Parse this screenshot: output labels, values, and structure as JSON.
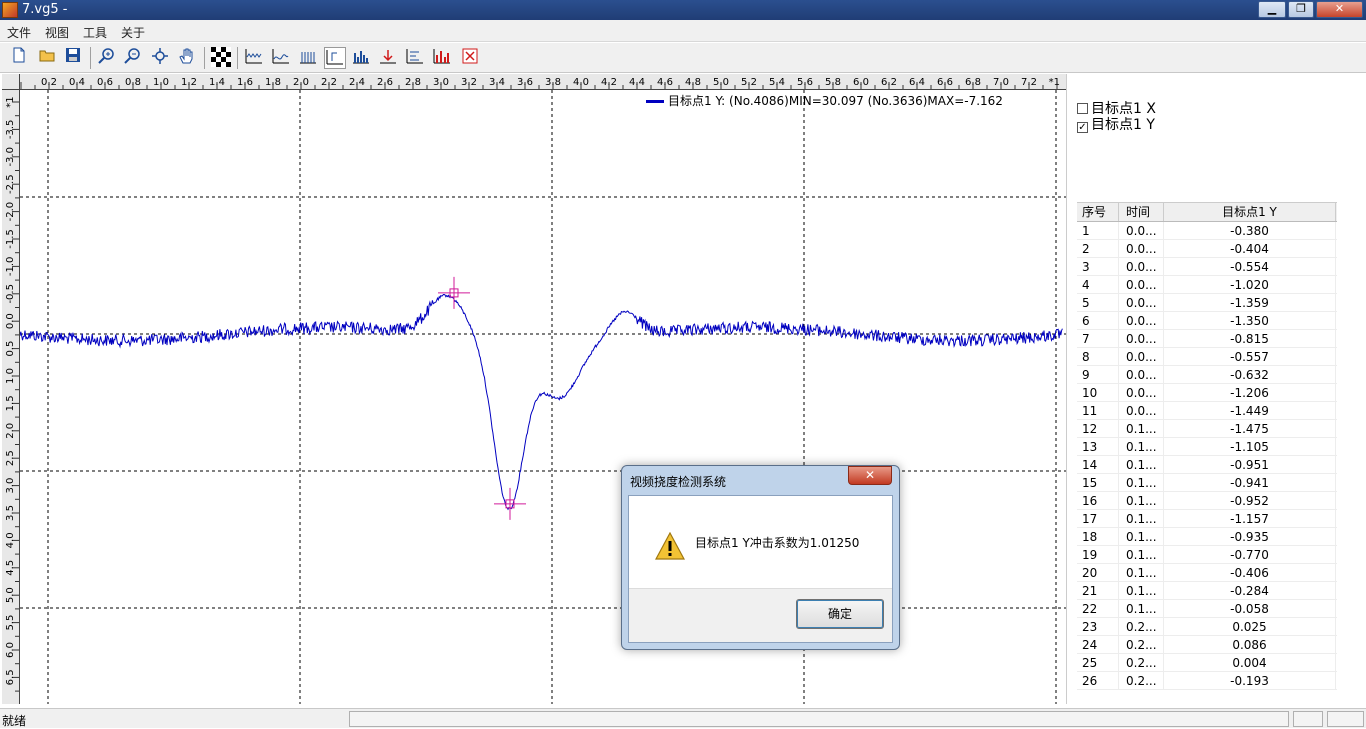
{
  "window": {
    "title": "7.vg5 -",
    "min": "▁",
    "max": "❐",
    "close": "✕"
  },
  "menu": [
    "文件",
    "视图",
    "工具",
    "关于"
  ],
  "toolbar_icons": [
    "new-file-icon",
    "open-folder-icon",
    "save-icon",
    "zoom-in-icon",
    "zoom-out-icon",
    "fit-view-icon",
    "pan-hand-icon",
    "checkerboard-icon",
    "wave-icon-1",
    "wave-icon-2",
    "bars-icon-1",
    "cursor-icon",
    "bars-icon-2",
    "marker-icon",
    "text-icon",
    "histogram-icon",
    "delete-icon"
  ],
  "rulers": {
    "h_ticks": [
      "0.2",
      "0.4",
      "0.6",
      "0.8",
      "1.0",
      "1.2",
      "1.4",
      "1.6",
      "1.8",
      "2.0",
      "2.2",
      "2.4",
      "2.6",
      "2.8",
      "3.0",
      "3.2",
      "3.4",
      "3.6",
      "3.8",
      "4.0",
      "4.2",
      "4.4",
      "4.6",
      "4.8",
      "5.0",
      "5.2",
      "5.4",
      "5.6",
      "5.8",
      "6.0",
      "6.2",
      "6.4",
      "6.6",
      "6.8",
      "7.0",
      "7.2"
    ],
    "h_end": "*1",
    "v_ticks": [
      "*1",
      "-3.5",
      "-3.0",
      "-2.5",
      "-2.0",
      "-1.5",
      "-1.0",
      "-0.5",
      "0.0",
      "0.5",
      "1.0",
      "1.5",
      "2.0",
      "2.5",
      "3.0",
      "3.5",
      "4.0",
      "4.5",
      "5.0",
      "5.5",
      "6.0",
      "6.5"
    ]
  },
  "chart_data": {
    "type": "line",
    "legend": "目标点1 Y: (No.4086)MIN=30.097  (No.3636)MAX=-7.162",
    "series": [
      {
        "name": "目标点1 Y",
        "color": "#0000c0"
      }
    ],
    "line_color": "#0000c0",
    "marker_color": "#d01a9a",
    "grid": true,
    "markers": [
      {
        "x": 3.1,
        "y": -0.75
      },
      {
        "x": 3.5,
        "y": 3.1
      }
    ]
  },
  "panel": {
    "checkboxes": [
      {
        "label": "目标点1 X",
        "checked": false,
        "mark": ""
      },
      {
        "label": "目标点1 Y",
        "checked": true,
        "mark": "✓"
      }
    ],
    "table_headers": [
      "序号",
      "时间",
      "目标点1 Y"
    ],
    "rows": [
      [
        "1",
        "0.0...",
        "-0.380"
      ],
      [
        "2",
        "0.0...",
        "-0.404"
      ],
      [
        "3",
        "0.0...",
        "-0.554"
      ],
      [
        "4",
        "0.0...",
        "-1.020"
      ],
      [
        "5",
        "0.0...",
        "-1.359"
      ],
      [
        "6",
        "0.0...",
        "-1.350"
      ],
      [
        "7",
        "0.0...",
        "-0.815"
      ],
      [
        "8",
        "0.0...",
        "-0.557"
      ],
      [
        "9",
        "0.0...",
        "-0.632"
      ],
      [
        "10",
        "0.0...",
        "-1.206"
      ],
      [
        "11",
        "0.0...",
        "-1.449"
      ],
      [
        "12",
        "0.1...",
        "-1.475"
      ],
      [
        "13",
        "0.1...",
        "-1.105"
      ],
      [
        "14",
        "0.1...",
        "-0.951"
      ],
      [
        "15",
        "0.1...",
        "-0.941"
      ],
      [
        "16",
        "0.1...",
        "-0.952"
      ],
      [
        "17",
        "0.1...",
        "-1.157"
      ],
      [
        "18",
        "0.1...",
        "-0.935"
      ],
      [
        "19",
        "0.1...",
        "-0.770"
      ],
      [
        "20",
        "0.1...",
        "-0.406"
      ],
      [
        "21",
        "0.1...",
        "-0.284"
      ],
      [
        "22",
        "0.1...",
        "-0.058"
      ],
      [
        "23",
        "0.2...",
        "0.025"
      ],
      [
        "24",
        "0.2...",
        "0.086"
      ],
      [
        "25",
        "0.2...",
        "0.004"
      ],
      [
        "26",
        "0.2...",
        "-0.193"
      ]
    ]
  },
  "status": {
    "text": "就绪"
  },
  "dialog": {
    "title": "视频挠度检测系统",
    "close": "✕",
    "message": "目标点1 Y冲击系数为1.01250",
    "ok_label": "确定"
  }
}
